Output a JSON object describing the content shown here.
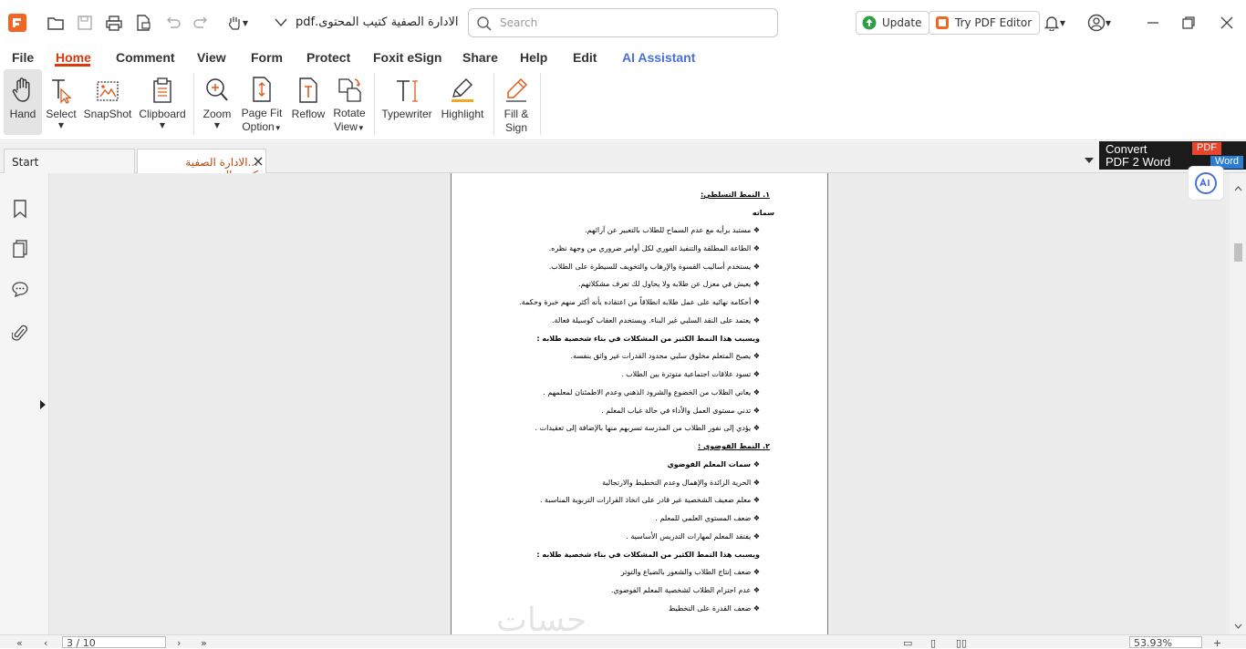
{
  "titlebar": {
    "doc_title": "الادارة الصفية كتيب المحتوى.pdf",
    "search_placeholder": "Search",
    "update_label": "Update",
    "try_editor_label": "Try PDF Editor"
  },
  "menu": {
    "tabs": [
      "File",
      "Home",
      "Comment",
      "View",
      "Form",
      "Protect",
      "Foxit eSign",
      "Share",
      "Help",
      "Edit",
      "AI Assistant"
    ],
    "active": "Home"
  },
  "ribbon": {
    "hand": "Hand",
    "select": "Select",
    "snapshot": "SnapShot",
    "clipboard": "Clipboard",
    "zoom": "Zoom",
    "page_fit_1": "Page Fit",
    "page_fit_2": "Option",
    "reflow": "Reflow",
    "rotate_1": "Rotate",
    "rotate_2": "View",
    "typewriter": "Typewriter",
    "highlight": "Highlight",
    "fill_sign_1": "Fill &",
    "fill_sign_2": "Sign"
  },
  "tabs": {
    "start": "Start",
    "doc": "...الادارة الصفية كتيب ال"
  },
  "convert": {
    "line1": "Convert",
    "line2": "PDF 2 Word",
    "pdf_badge": "PDF",
    "word_badge": "Word"
  },
  "document": {
    "lines": [
      "١.  النمط التسلطي:",
      "سماته",
      "❖  مستبد برأيه مع عدم السماح للطلاب بالتعبير عن آرائهم.",
      "❖  الطاعة المطلقة والتنفيذ الفوري لكل أوامر ضروري من وجهة نظره.",
      "❖  يستخدم أساليب القسوة والإرهاب والتخويف للسيطرة على الطلاب.",
      "❖  يعيش في معزل عن طلابه ولا يحاول لك تعرف مشكلاتهم.",
      "❖  أحكامه نهائيه على عمل طلابه انطلاقاً من اعتقاده بأنه أكثر منهم خبرة وحكمة.",
      "❖  يعتمد على النقد السلبي غير البناء. ويستخدم العقاب كوسيلة فعالة.",
      "ويسبب هذا النمط الكثير من المشكلات في بناء شخصية طلابه :",
      "❖  يصبح المتعلم مخلوق سلبي محدود القدرات غير واثق بنفسه.",
      "❖  تسود علاقات اجتماعية متوترة بين الطلاب .",
      "❖  يعاني الطلاب من الخضوع والشرود الذهني وعدم الاطمئنان لمعلمهم .",
      "❖  تدني مستوى العمل والأداء في حالة غياب المعلم .",
      "❖  يؤدي إلى نفور الطلاب  من المدرسة تسربهم منها بالإضافة إلى تعقيدات .",
      "٢.  النمط الفوضوي :",
      "❖  سمات المعلم الفوضوي",
      "❖  الحرية الزائدة والإهمال وعدم التخطيط والارتجالية",
      "❖  معلم ضعيف الشخصية غير قادر على اتخاذ القرارات التربوية المناسبة .",
      "❖  ضعف المستوي العلمي للمعلم .",
      "❖  يفتقد المعلم  لمهارات التدريس الأساسية .",
      "ويسبب هذا النمط الكثير من المشكلات في بناء شخصية طلابه :",
      "❖  ضعف إنتاج الطلاب والشعور بالضياع والتوتر",
      "❖  عدم احترام الطلاب لشخصية المعلم الفوضوي.",
      "❖  ضعف القدرة على التخطيط"
    ],
    "watermark": "حسات"
  },
  "status": {
    "page": "3 / 10",
    "zoom": "53.93%"
  },
  "colors": {
    "accent": "#d93a0b",
    "ai": "#4a6fd8"
  }
}
